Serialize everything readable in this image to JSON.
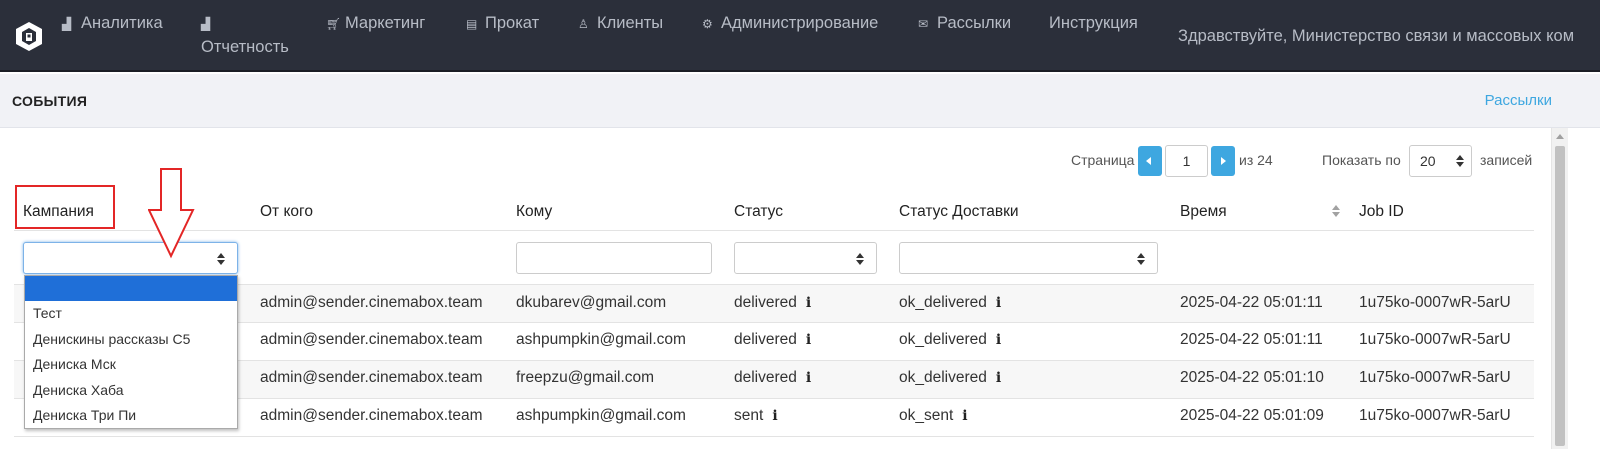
{
  "nav": {
    "items": [
      {
        "label": "Аналитика",
        "icon": "bar-chart-icon"
      },
      {
        "label": "",
        "icon": "bar-chart-icon",
        "sub": "Отчетность"
      },
      {
        "label": "Маркетинг",
        "icon": "cart-icon"
      },
      {
        "label": "Прокат",
        "icon": "film-icon"
      },
      {
        "label": "Клиенты",
        "icon": "user-icon"
      },
      {
        "label": "Администрирование",
        "icon": "cogs-icon"
      },
      {
        "label": "Рассылки",
        "icon": "envelope-icon"
      },
      {
        "label": "Инструкция",
        "icon": ""
      }
    ],
    "greeting": "Здравствуйте, Министерство связи и массовых ком"
  },
  "header": {
    "title": "СОБЫТИЯ",
    "link": "Рассылки"
  },
  "pager": {
    "page_label": "Страница",
    "page": "1",
    "of_label": "из 24",
    "show_label": "Показать по",
    "per_page": "20",
    "records_label": "записей"
  },
  "table": {
    "columns": [
      "Кампания",
      "От кого",
      "Кому",
      "Статус",
      "Статус Доставки",
      "Время",
      "Job ID"
    ],
    "rows": [
      {
        "from": "admin@sender.cinemabox.team",
        "to": "dkubarev@gmail.com",
        "status": "delivered",
        "delivery": "ok_delivered",
        "time": "2025-04-22 05:01:11",
        "job": "1u75ko-0007wR-5arU"
      },
      {
        "from": "admin@sender.cinemabox.team",
        "to": "ashpumpkin@gmail.com",
        "status": "delivered",
        "delivery": "ok_delivered",
        "time": "2025-04-22 05:01:11",
        "job": "1u75ko-0007wR-5arU"
      },
      {
        "from": "admin@sender.cinemabox.team",
        "to": "freepzu@gmail.com",
        "status": "delivered",
        "delivery": "ok_delivered",
        "time": "2025-04-22 05:01:10",
        "job": "1u75ko-0007wR-5arU"
      },
      {
        "from": "admin@sender.cinemabox.team",
        "to": "ashpumpkin@gmail.com",
        "status": "sent",
        "delivery": "ok_sent",
        "time": "2025-04-22 05:01:09",
        "job": "1u75ko-0007wR-5arU"
      }
    ]
  },
  "campaign_dropdown": {
    "options": [
      "",
      "Тест",
      "Денискины рассказы С5",
      "Дениска Мск",
      "Дениска Хаба",
      "Дениска Три Пи"
    ],
    "highlighted_index": 0
  },
  "colors": {
    "accent": "#3ea7e0",
    "nav_bg": "#2b2f3a",
    "annotation": "#e32626",
    "selection": "#1f6fd8"
  }
}
